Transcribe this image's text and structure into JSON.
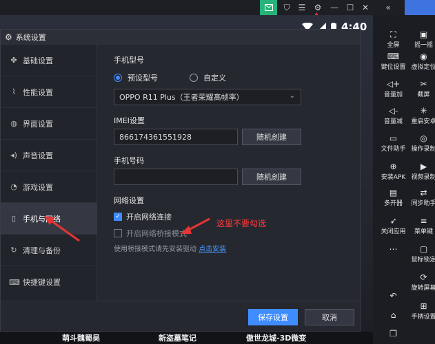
{
  "topbar": {
    "icons": [
      "mail-icon",
      "shirt-icon",
      "menu-icon",
      "settings-icon",
      "minimize-icon",
      "maximize-icon",
      "close-icon",
      "collapse-icon"
    ]
  },
  "status": {
    "time": "4:40"
  },
  "sidebar": {
    "items": [
      {
        "label": "全屏",
        "icon": "fullscreen-icon"
      },
      {
        "label": "摇一摇",
        "icon": "shake-icon"
      },
      {
        "label": "键位设置",
        "icon": "keyboard-icon"
      },
      {
        "label": "虚拟定位",
        "icon": "location-icon"
      },
      {
        "label": "音量加",
        "icon": "volume-up-icon"
      },
      {
        "label": "截屏",
        "icon": "scissors-icon"
      },
      {
        "label": "音量减",
        "icon": "volume-down-icon"
      },
      {
        "label": "重启安卓",
        "icon": "restart-icon"
      },
      {
        "label": "文件助手",
        "icon": "file-icon"
      },
      {
        "label": "操作录制",
        "icon": "record-icon"
      },
      {
        "label": "安装APK",
        "icon": "apk-icon"
      },
      {
        "label": "视频录制",
        "icon": "video-icon"
      },
      {
        "label": "多开器",
        "icon": "multi-icon"
      },
      {
        "label": "同步助手",
        "icon": "sync-icon"
      },
      {
        "label": "关闭应用",
        "icon": "rocket-icon"
      },
      {
        "label": "菜单键",
        "icon": "menu-key-icon"
      },
      {
        "label": "",
        "icon": "more-icon"
      },
      {
        "label": "鼠标锁定",
        "icon": "mouse-lock-icon"
      },
      {
        "label": "",
        "icon": "back-icon"
      },
      {
        "label": "旋转屏幕",
        "icon": "rotate-icon"
      },
      {
        "label": "",
        "icon": "home-icon"
      },
      {
        "label": "手柄设置",
        "icon": "gamepad-icon"
      },
      {
        "label": "",
        "icon": "recent-icon"
      }
    ]
  },
  "dialog": {
    "title": "系统设置",
    "nav": [
      {
        "label": "基础设置",
        "icon": "puzzle-icon"
      },
      {
        "label": "性能设置",
        "icon": "performance-icon"
      },
      {
        "label": "界面设置",
        "icon": "palette-icon"
      },
      {
        "label": "声音设置",
        "icon": "sound-icon"
      },
      {
        "label": "游戏设置",
        "icon": "game-icon"
      },
      {
        "label": "手机与网络",
        "icon": "phone-icon"
      },
      {
        "label": "清理与备份",
        "icon": "clean-icon"
      },
      {
        "label": "快捷键设置",
        "icon": "shortcut-icon"
      }
    ],
    "active_nav": "手机与网络",
    "phone_model_label": "手机型号",
    "radio_preset": "预设型号",
    "radio_custom": "自定义",
    "model_value": "OPPO R11 Plus（王者荣耀高帧率）",
    "imei_label": "IMEI设置",
    "imei_value": "866174361551928",
    "random_create": "随机创建",
    "phone_number_label": "手机号码",
    "phone_number_value": "",
    "network_label": "网络设置",
    "enable_network": "开启网络连接",
    "enable_bridge": "开启网络桥接模式",
    "bridge_hint": "使用桥接模式请先安装驱动",
    "install_link": "点击安装",
    "annotation": "这里不要勾选",
    "save": "保存设置",
    "cancel": "取消"
  },
  "games": [
    "萌斗魏蜀吴",
    "新盗墓笔记",
    "傲世龙城-3D微变"
  ]
}
